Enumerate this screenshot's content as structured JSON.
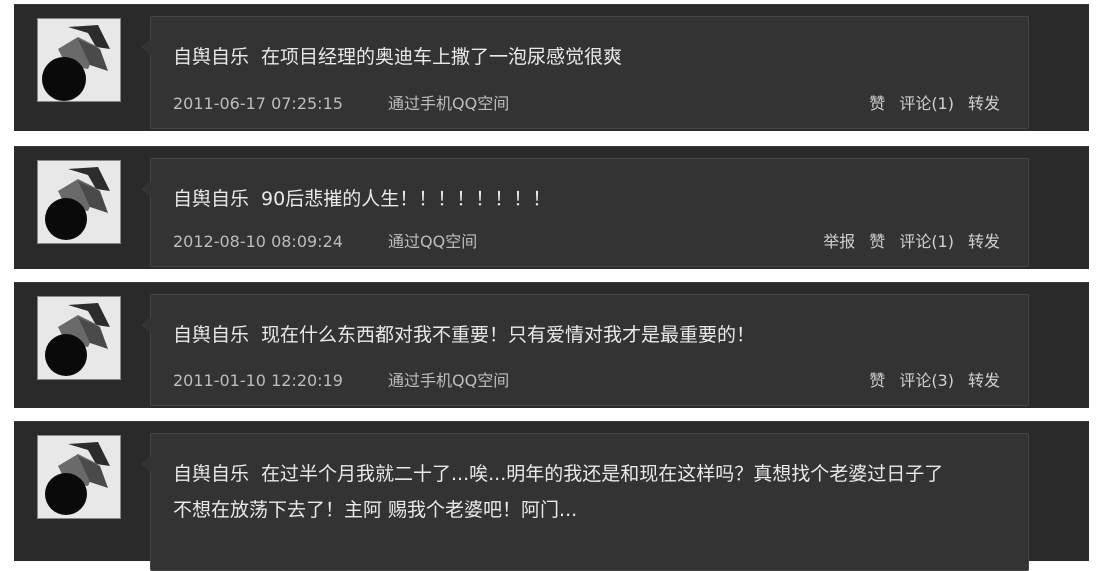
{
  "posts": [
    {
      "author": "自舆自乐",
      "content": "在项目经理的奥迪车上撒了一泡尿感觉很爽",
      "date": "2011-06-17 07:25:15",
      "via": "通过手机QQ空间",
      "actions": {
        "report": "",
        "like": "赞",
        "comment": "评论(1)",
        "share": "转发"
      }
    },
    {
      "author": "自舆自乐",
      "content": "90后悲摧的人生！！！！！！！！",
      "date": "2012-08-10 08:09:24",
      "via": "通过QQ空间",
      "actions": {
        "report": "举报",
        "like": "赞",
        "comment": "评论(1)",
        "share": "转发"
      }
    },
    {
      "author": "自舆自乐",
      "content": "现在什么东西都对我不重要！只有爱情对我才是最重要的！",
      "date": "2011-01-10 12:20:19",
      "via": "通过手机QQ空间",
      "actions": {
        "report": "",
        "like": "赞",
        "comment": "评论(3)",
        "share": "转发"
      }
    },
    {
      "author": "自舆自乐",
      "content": "在过半个月我就二十了...唉...明年的我还是和现在这样吗？真想找个老婆过日子了 不想在放荡下去了！主阿 赐我个老婆吧！阿门...",
      "date": "",
      "via": "",
      "actions": {
        "report": "",
        "like": "",
        "comment": "",
        "share": ""
      }
    }
  ],
  "colors": {
    "panel_bg": "#2a2a2a",
    "bubble_bg": "#333333",
    "text": "#e9e9e9",
    "meta_text": "#bdbdbd"
  },
  "icons": {
    "avatar": "avatar-icon"
  }
}
